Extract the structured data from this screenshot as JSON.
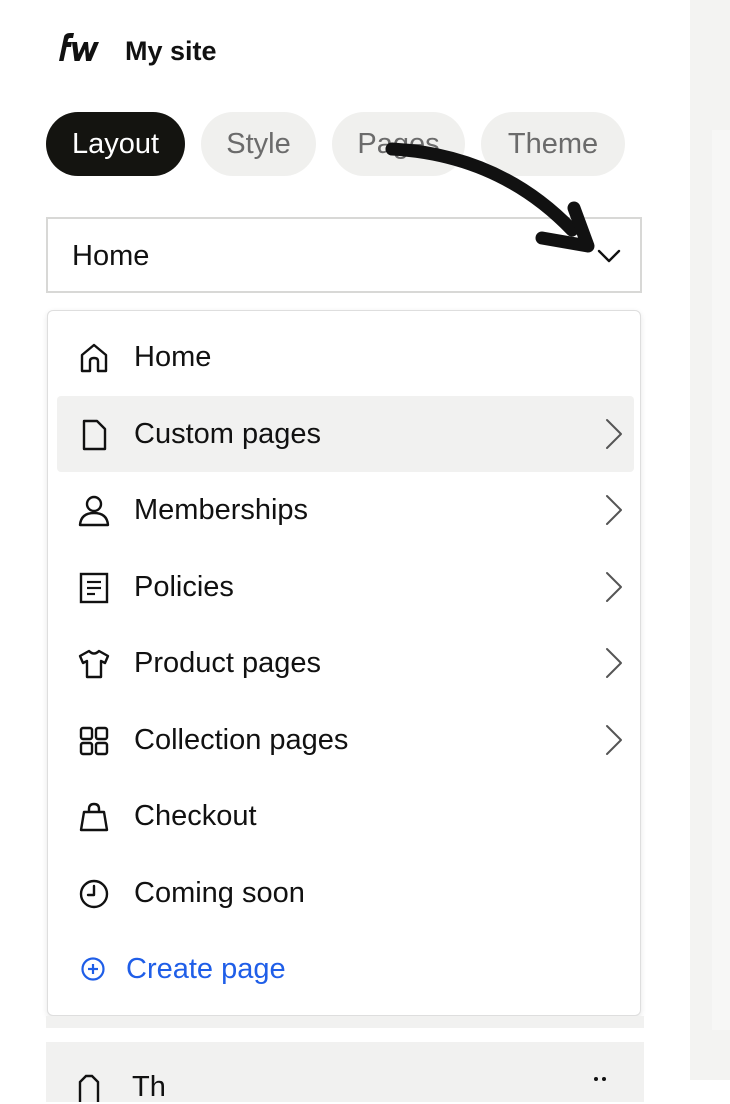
{
  "header": {
    "logo_icon": "fw-logo",
    "site_title": "My site"
  },
  "tabs": [
    {
      "label": "Layout",
      "active": true
    },
    {
      "label": "Style",
      "active": false
    },
    {
      "label": "Pages",
      "active": false
    },
    {
      "label": "Theme",
      "active": false
    }
  ],
  "page_select": {
    "value": "Home",
    "icon": "chevron-down-icon"
  },
  "menu": {
    "items": [
      {
        "label": "Home",
        "icon": "home-icon",
        "has_submenu": false
      },
      {
        "label": "Custom pages",
        "icon": "page-icon",
        "has_submenu": true,
        "highlighted": true
      },
      {
        "label": "Memberships",
        "icon": "user-icon",
        "has_submenu": true
      },
      {
        "label": "Policies",
        "icon": "document-list-icon",
        "has_submenu": true
      },
      {
        "label": "Product pages",
        "icon": "tshirt-icon",
        "has_submenu": true
      },
      {
        "label": "Collection pages",
        "icon": "grid-icon",
        "has_submenu": true
      },
      {
        "label": "Checkout",
        "icon": "shopping-bag-icon",
        "has_submenu": false
      },
      {
        "label": "Coming soon",
        "icon": "clock-icon",
        "has_submenu": false
      }
    ],
    "create_label": "Create page",
    "create_icon": "plus-circle-icon"
  },
  "bottom_row": {
    "label": "Th"
  },
  "colors": {
    "accent_blue": "#1f5ee8",
    "active_tab_bg": "#141410",
    "tab_bg": "#f0f0ee",
    "highlight_bg": "#f1f1f0"
  }
}
